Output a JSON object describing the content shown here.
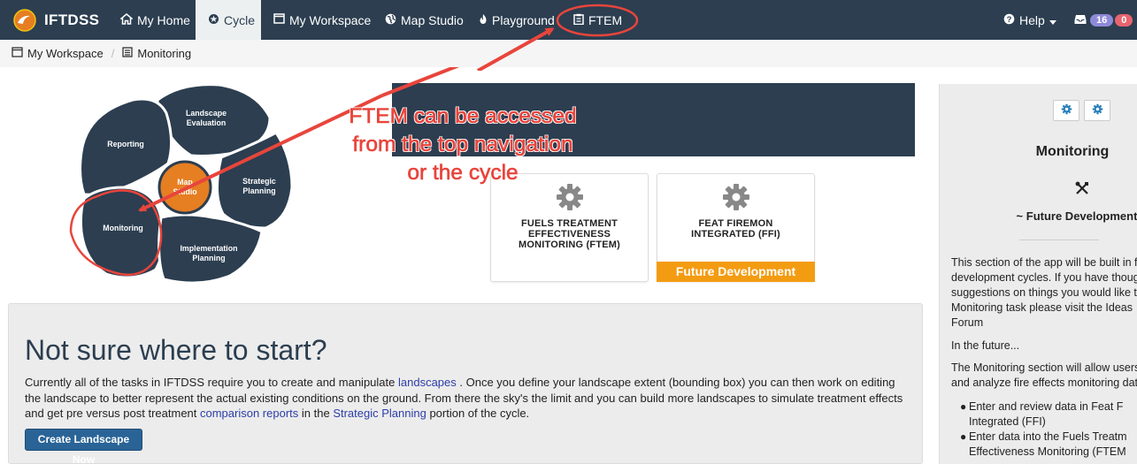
{
  "navbar": {
    "brand": "IFTDSS",
    "items": [
      {
        "label": "My Home",
        "icon": "home-icon"
      },
      {
        "label": "Cycle",
        "icon": "cycle-icon"
      },
      {
        "label": "My Workspace",
        "icon": "window-icon"
      },
      {
        "label": "Map Studio",
        "icon": "globe-icon"
      },
      {
        "label": "Playground",
        "icon": "fire-icon"
      },
      {
        "label": "FTEM",
        "icon": "clipboard-icon"
      }
    ],
    "help": "Help",
    "badge_blue": "16",
    "badge_red": "0",
    "colors": {
      "bar": "#2c3e50",
      "active": "#ecf0f1",
      "badge_blue": "#8e89d9",
      "badge_red": "#e8646f"
    }
  },
  "breadcrumb": {
    "items": [
      {
        "label": "My Workspace",
        "icon": "window-icon"
      },
      {
        "label": "Monitoring",
        "icon": "list-icon"
      }
    ]
  },
  "cycle": {
    "segments": {
      "landscape_line1": "Landscape",
      "landscape_line2": "Evaluation",
      "reporting": "Reporting",
      "strategic_line1": "Strategic",
      "strategic_line2": "Planning",
      "monitoring": "Monitoring",
      "implementation_line1": "Implementation",
      "implementation_line2": "Planning",
      "center_line1": "Map",
      "center_line2": "Studio"
    },
    "colors": {
      "segment": "#2c3e50",
      "center": "#e67e22"
    }
  },
  "annotation": {
    "line1": "FTEM can be accessed",
    "line2": "from the top navigation",
    "line3": "or the cycle",
    "color": "#e8453c"
  },
  "cards": [
    {
      "title_line1": "FUELS TREATMENT",
      "title_line2": "EFFECTIVENESS",
      "title_line3": "MONITORING (FTEM)",
      "icon": "gear-icon"
    },
    {
      "title_line1": "FEAT FIREMON",
      "title_line2": "INTEGRATED (FFI)",
      "icon": "gear-icon",
      "footer": "Future Development",
      "footer_color": "#f39c12"
    }
  ],
  "right_panel": {
    "title": "Monitoring",
    "icon": "tools-icon",
    "subtitle": "~ Future Development",
    "para1_line1": "This section of the app will be built in f",
    "para1_line2": "development cycles. If you have thoug",
    "para1_line3": "suggestions on things you would like t",
    "para1_line4": "Monitoring task please visit the Ideas",
    "para1_line5": "Forum",
    "para2": "In the future...",
    "para3_line1": "The Monitoring section will allow users",
    "para3_line2": "and analyze fire effects monitoring dat",
    "bullet1_line1": "Enter and review data in Feat F",
    "bullet1_line2": "Integrated (FFI)",
    "bullet2_line1": "Enter data into the Fuels Treatm",
    "bullet2_line2": "Effectiveness Monitoring (FTEM"
  },
  "start": {
    "title": "Not sure where to start?",
    "p_1": "Currently all of the tasks in IFTDSS require you to create and manipulate ",
    "link_landscapes": "landscapes",
    "p_2": " . Once you define your landscape extent (bounding box) you can then work on editing the landscape to better represent the actual existing conditions on the ground. From there the sky's the limit and you can build more landscapes to simulate treatment effects and get pre versus post treatment ",
    "link_comparison": "comparison reports",
    "p_3": " in the ",
    "link_strategic": "Strategic Planning",
    "p_4": " portion of the cycle.",
    "button": "Create Landscape Now"
  }
}
